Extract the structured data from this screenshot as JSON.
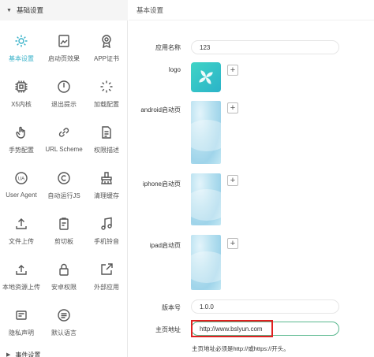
{
  "sidebar": {
    "header": "基础设置",
    "footer": "事件设置",
    "tiles": [
      {
        "label": "基本设置",
        "icon": "gear-icon"
      },
      {
        "label": "启动页效果",
        "icon": "image-icon"
      },
      {
        "label": "APP证书",
        "icon": "certificate-icon"
      },
      {
        "label": "X5内核",
        "icon": "chip-icon"
      },
      {
        "label": "退出提示",
        "icon": "power-icon"
      },
      {
        "label": "加载配置",
        "icon": "loading-icon"
      },
      {
        "label": "手势配置",
        "icon": "hand-icon"
      },
      {
        "label": "URL Scheme",
        "icon": "link-icon"
      },
      {
        "label": "权限描述",
        "icon": "document-icon"
      },
      {
        "label": "User Agent",
        "icon": "ua-icon"
      },
      {
        "label": "自动运行JS",
        "icon": "copyright-icon"
      },
      {
        "label": "清理缓存",
        "icon": "broom-icon"
      },
      {
        "label": "文件上传",
        "icon": "upload-icon"
      },
      {
        "label": "剪切板",
        "icon": "clipboard-icon"
      },
      {
        "label": "手机铃音",
        "icon": "music-icon"
      },
      {
        "label": "本地资源上传",
        "icon": "local-upload-icon"
      },
      {
        "label": "安卓权限",
        "icon": "lock-icon"
      },
      {
        "label": "外部应用",
        "icon": "external-icon"
      },
      {
        "label": "隐私声明",
        "icon": "privacy-icon"
      },
      {
        "label": "默认语言",
        "icon": "language-icon"
      }
    ]
  },
  "main": {
    "header": "基本设置",
    "app_name_label": "应用名称",
    "app_name_value": "123",
    "logo_label": "logo",
    "android_label": "android启动页",
    "iphone_label": "iphone启动页",
    "ipad_label": "ipad启动页",
    "version_label": "版本号",
    "version_value": "1.0.0",
    "homepage_label": "主页地址",
    "homepage_value": "http://www.bslyun.com",
    "homepage_hint": "主页地址必须是http://或https://开头。"
  },
  "colors": {
    "accent": "#38b2c9",
    "highlight": "#e02020"
  }
}
